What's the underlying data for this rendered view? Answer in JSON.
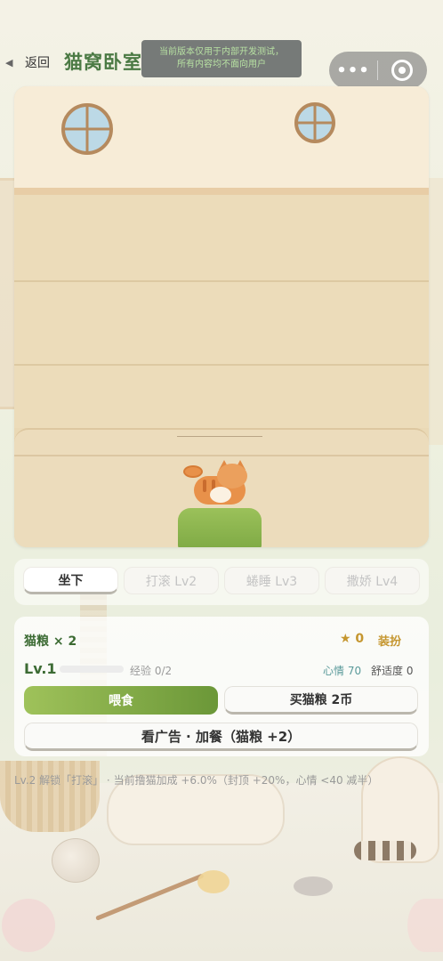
{
  "nav": {
    "back_label": "返回",
    "title": "猫窝卧室",
    "toast_line1": "当前版本仅用于内部开发测试，",
    "toast_line2": "所有内容均不面向用户",
    "more_glyph": "•••"
  },
  "tabs": [
    {
      "label": "坐下",
      "active": true
    },
    {
      "label": "打滚 Lv2",
      "active": false
    },
    {
      "label": "蜷睡 Lv3",
      "active": false
    },
    {
      "label": "撒娇 Lv4",
      "active": false
    }
  ],
  "panel": {
    "food": "猫粮 × 2",
    "stars": "★ 0",
    "dress_label": "装扮",
    "level": "Lv.1",
    "xp_progress": 0,
    "xp_text": "经验 0/2",
    "mood": "心情 70",
    "comfort": "舒适度 0",
    "feed_button": "喂食",
    "buy_button": "买猫粮 2币",
    "ad_button": "看广告 · 加餐（猫粮 +2）"
  },
  "footnote": "Lv.2 解锁「打滚」 · 当前撸猫加成 +6.0%（封顶 +20%，心情 <40 减半）",
  "colors": {
    "accent_green": "#4b7a44",
    "feed_button": "#7faa45",
    "gold": "#c5962f",
    "mood": "#5a9a9a"
  }
}
